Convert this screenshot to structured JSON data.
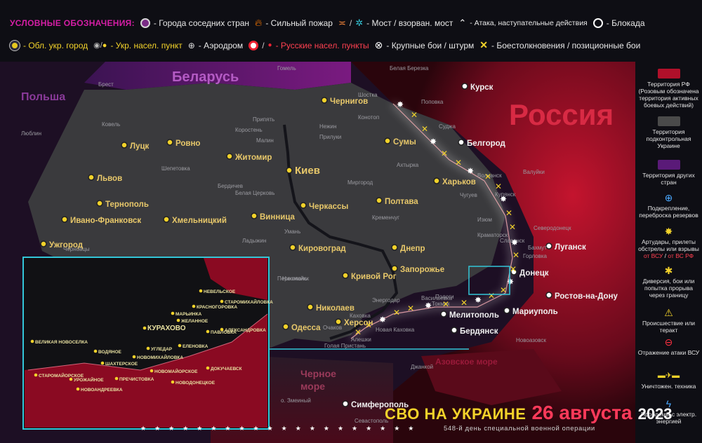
{
  "legend": {
    "title": "УСЛОВНЫЕ ОБОЗНАЧЕНИЯ:",
    "row1": [
      {
        "icon": "neighbor-city-icon",
        "label": "- Города соседних стран"
      },
      {
        "icon": "fire-icon",
        "label": "- Сильный пожар"
      },
      {
        "icon": "bridge-icon",
        "label": "- Мост / взорван. мост"
      },
      {
        "icon": "attack-icon",
        "label": "- Атака, наступательные действия"
      },
      {
        "icon": "blockade-icon",
        "label": "- Блокада"
      }
    ],
    "row2": [
      {
        "icon": "oblast-city-icon",
        "label": "- Обл. укр. город"
      },
      {
        "icon": "settlement-icon",
        "label": "- Укр. насел. пункт"
      },
      {
        "icon": "airfield-icon",
        "label": "- Аэродром"
      },
      {
        "icon": "russian-settlement-icon",
        "label": "- Русские  насел. пункты"
      },
      {
        "icon": "assault-icon",
        "label": "- Крупные бои / штурм"
      },
      {
        "icon": "clash-icon",
        "label": "- Боестолкновения / позиционные бои"
      }
    ]
  },
  "right_legend": [
    {
      "name": "territory-rf",
      "label": "Территория РФ (Розовым обозначена территория активных боевых действий)",
      "color": "#b0102a"
    },
    {
      "name": "territory-ukraine",
      "label": "Территория подконтрольная Украине",
      "color": "#4a4a4a"
    },
    {
      "name": "territory-other",
      "label": "Территория других стран",
      "color": "#5a1a78"
    },
    {
      "name": "reinforcement",
      "label": "Подкрепление, переброска резервов",
      "icon": "+"
    },
    {
      "name": "artillery",
      "label": "Артудары, прилеты обстрелы или взрывы",
      "sub_a": "от ВСУ",
      "sub_sep": " / ",
      "sub_b": "от ВС РФ"
    },
    {
      "name": "diversion",
      "label": "Диверсия, бои или попытка прорыва через границу"
    },
    {
      "name": "incident",
      "label": "Происшествие или теракт"
    },
    {
      "name": "repel",
      "label": "Отражение атаки ВСУ"
    },
    {
      "name": "destroyed",
      "label": "Уничтожен. техника"
    },
    {
      "name": "power",
      "label": "Проблемы с электр. энергией"
    }
  ],
  "countries": {
    "belarus": "Беларусь",
    "poland": "Польша",
    "russia": "Россия",
    "azov": "Азовское море",
    "black_sea_1": "Черное",
    "black_sea_2": "море"
  },
  "cities_big": [
    {
      "name": "Киев"
    },
    {
      "name": "Чернигов"
    },
    {
      "name": "Сумы"
    },
    {
      "name": "Харьков"
    },
    {
      "name": "Полтава"
    },
    {
      "name": "Черкассы"
    },
    {
      "name": "Винница"
    },
    {
      "name": "Житомир"
    },
    {
      "name": "Ровно"
    },
    {
      "name": "Луцк"
    },
    {
      "name": "Львов"
    },
    {
      "name": "Тернополь"
    },
    {
      "name": "Ивано-Франковск"
    },
    {
      "name": "Хмельницкий"
    },
    {
      "name": "Ужгород"
    },
    {
      "name": "Кировоград"
    },
    {
      "name": "Днепр"
    },
    {
      "name": "Запорожье"
    },
    {
      "name": "Кривой Рог"
    },
    {
      "name": "Николаев"
    },
    {
      "name": "Одесса"
    },
    {
      "name": "Херсон"
    },
    {
      "name": "Мелитополь"
    },
    {
      "name": "Донецк"
    },
    {
      "name": "Луганск"
    },
    {
      "name": "Мариуполь"
    },
    {
      "name": "Симферополь"
    },
    {
      "name": "Белгород"
    },
    {
      "name": "Курск"
    },
    {
      "name": "Ростов-на-Дону"
    },
    {
      "name": "Бердянск"
    }
  ],
  "cities_small": [
    {
      "name": "Брест"
    },
    {
      "name": "Гомель"
    },
    {
      "name": "Люблин"
    },
    {
      "name": "Ковель"
    },
    {
      "name": "Припять"
    },
    {
      "name": "Нежин"
    },
    {
      "name": "Конотоп"
    },
    {
      "name": "Шостка"
    },
    {
      "name": "Прилуки"
    },
    {
      "name": "Миргород"
    },
    {
      "name": "Ахтырка"
    },
    {
      "name": "Белая Церковь"
    },
    {
      "name": "Умань"
    },
    {
      "name": "Кременчуг"
    },
    {
      "name": "Никополь"
    },
    {
      "name": "Энергодар"
    },
    {
      "name": "Каховка"
    },
    {
      "name": "Новая Каховка"
    },
    {
      "name": "Голая Пристань"
    },
    {
      "name": "Алешки"
    },
    {
      "name": "Очаков"
    },
    {
      "name": "Вознесенск"
    },
    {
      "name": "Первомайск"
    },
    {
      "name": "Изюм"
    },
    {
      "name": "Купянск"
    },
    {
      "name": "Волчанск"
    },
    {
      "name": "Чугуев"
    },
    {
      "name": "Славянск"
    },
    {
      "name": "Краматорск"
    },
    {
      "name": "Бахмут"
    },
    {
      "name": "Северодонецк"
    },
    {
      "name": "Горловка"
    },
    {
      "name": "Валуйки"
    },
    {
      "name": "Суджа"
    },
    {
      "name": "Поповка"
    },
    {
      "name": "Белая Березка"
    },
    {
      "name": "Новоазовск"
    },
    {
      "name": "Токмак"
    },
    {
      "name": "Пологи"
    },
    {
      "name": "Васильевка"
    },
    {
      "name": "Джанкой"
    },
    {
      "name": "Севастополь"
    },
    {
      "name": "о. Змеиный"
    },
    {
      "name": "Ладыжин"
    },
    {
      "name": "Кременец"
    },
    {
      "name": "Черновцы"
    },
    {
      "name": "Шепетовка"
    },
    {
      "name": "Бердичев"
    },
    {
      "name": "Коростень"
    },
    {
      "name": "Малин"
    }
  ],
  "inset": {
    "labels": [
      {
        "name": "КУРАХОВО"
      },
      {
        "name": "ВЕЛИКАЯ НОВОСЕЛКА"
      },
      {
        "name": "МАРЬИНКА"
      },
      {
        "name": "НЕВЕЛЬСКОЕ"
      },
      {
        "name": "КРАСНОГОРОВКА"
      },
      {
        "name": "СТАРОМИХАЙЛОВКА"
      },
      {
        "name": "ЖЕЛАННОЕ"
      },
      {
        "name": "УГЛЕДАР"
      },
      {
        "name": "ПАВЛОВКА"
      },
      {
        "name": "НОВОМИХАЙЛОВКА"
      },
      {
        "name": "СТАРОМАЙОРСКОЕ"
      },
      {
        "name": "УРОЖАЙНОЕ"
      },
      {
        "name": "ШАХТЕРСКОЕ"
      },
      {
        "name": "ВОДЯНОЕ"
      },
      {
        "name": "ПРЕЧИСТОВКА"
      },
      {
        "name": "НОВОМАЙОРСКОЕ"
      },
      {
        "name": "АЛЕКСАНДРОВКА"
      },
      {
        "name": "ЕЛЕНОВКА"
      },
      {
        "name": "ДОКУЧАЕВСК"
      },
      {
        "name": "НОВОДОНЕЦКОЕ"
      },
      {
        "name": "НОВОАНДРЕЕВКА"
      }
    ]
  },
  "banner": {
    "title": "СВО НА УКРАИНЕ",
    "date": "26 августа",
    "year": "2023",
    "subtitle": "548-й день специальной военной операции",
    "stars": "★★★★★★★★★★★★★★★★★★★★"
  },
  "colors": {
    "rf": "#b0102a",
    "ua": "#3a3a3d",
    "other": "#3a1848",
    "accent_yellow": "#f2d22a",
    "accent_magenta": "#d61ea6",
    "inset_border": "#33c6d8"
  }
}
